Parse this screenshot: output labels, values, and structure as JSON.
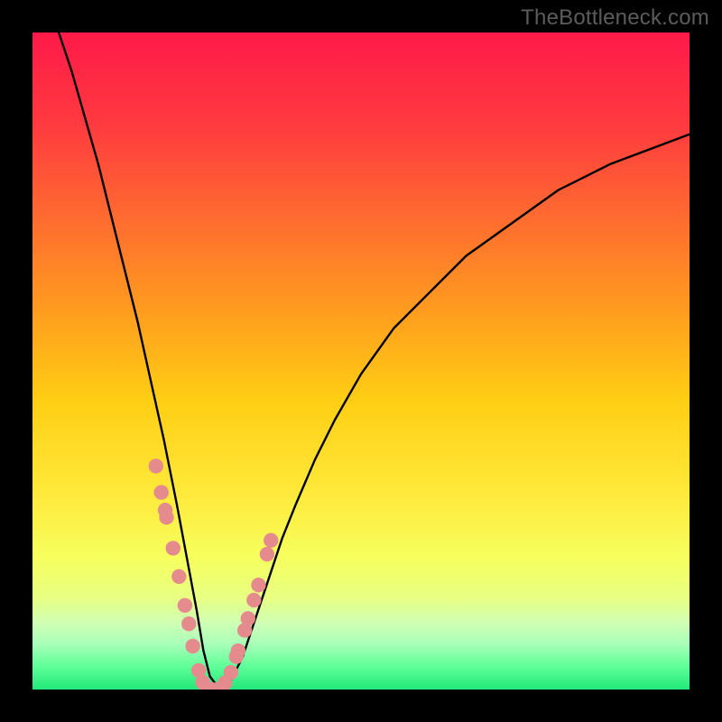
{
  "watermark": "TheBottleneck.com",
  "colors": {
    "frame": "#000000",
    "curve": "#000000",
    "marker_fill": "#e58b8d",
    "marker_stroke": "#d37679",
    "gradient_stops": [
      {
        "offset": 0.0,
        "color": "#ff1a49"
      },
      {
        "offset": 0.14,
        "color": "#ff3a3f"
      },
      {
        "offset": 0.28,
        "color": "#ff6a30"
      },
      {
        "offset": 0.42,
        "color": "#ff9b1f"
      },
      {
        "offset": 0.56,
        "color": "#ffce14"
      },
      {
        "offset": 0.7,
        "color": "#ffe93a"
      },
      {
        "offset": 0.8,
        "color": "#f6ff5e"
      },
      {
        "offset": 0.86,
        "color": "#e8ff82"
      },
      {
        "offset": 0.9,
        "color": "#cfffb6"
      },
      {
        "offset": 0.93,
        "color": "#aaffb9"
      },
      {
        "offset": 0.965,
        "color": "#5fff99"
      },
      {
        "offset": 1.0,
        "color": "#22e87a"
      }
    ]
  },
  "chart_data": {
    "type": "line",
    "title": "",
    "xlabel": "",
    "ylabel": "",
    "xlim": [
      0,
      100
    ],
    "ylim": [
      0,
      100
    ],
    "grid": false,
    "legend": false,
    "series": [
      {
        "name": "bottleneck-curve",
        "x": [
          4,
          6,
          8,
          10,
          12,
          14,
          16,
          18,
          20,
          22,
          23.5,
          25,
          26,
          27,
          28.5,
          30,
          32,
          34,
          36,
          38,
          40,
          43,
          46,
          50,
          55,
          60,
          66,
          73,
          80,
          88,
          96,
          100
        ],
        "y": [
          100,
          94,
          87,
          80,
          72,
          64,
          56,
          47,
          38,
          28,
          20,
          12,
          6,
          2,
          0,
          1,
          5,
          11,
          17,
          23,
          28,
          35,
          41,
          48,
          55,
          60,
          66,
          71,
          76,
          80,
          83,
          84.5
        ]
      }
    ],
    "markers": {
      "name": "highlight-points",
      "x": [
        18.8,
        19.6,
        20.2,
        20.4,
        21.4,
        22.3,
        23.2,
        23.8,
        24.4,
        25.3,
        25.9,
        26.5,
        27.3,
        28.2,
        29.3,
        30.2,
        31.0,
        31.3,
        32.3,
        32.8,
        33.7,
        34.4,
        35.7,
        36.3
      ],
      "y": [
        34.0,
        30.0,
        27.3,
        26.2,
        21.5,
        17.2,
        12.8,
        10.0,
        6.6,
        2.9,
        1.1,
        0.0,
        0.0,
        0.0,
        1.0,
        2.6,
        5.0,
        5.9,
        9.0,
        10.8,
        13.6,
        15.9,
        20.6,
        22.7
      ]
    },
    "notes": "V-shaped bottleneck curve. X axis implied component ratio 0–100; Y axis implied bottleneck percentage 0–100 (top). Minimum near x≈28.5."
  }
}
